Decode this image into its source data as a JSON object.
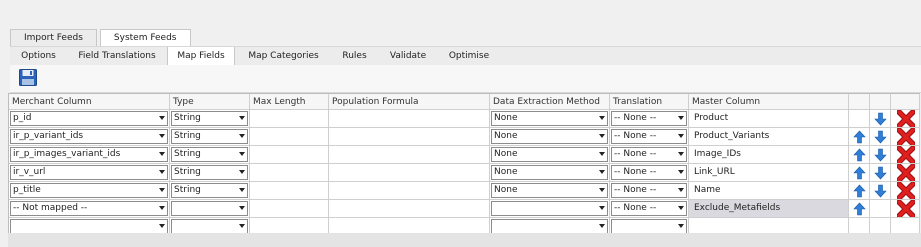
{
  "top_tabs": [
    {
      "label": "Import Feeds",
      "active": false
    },
    {
      "label": "System Feeds",
      "active": true
    }
  ],
  "sub_tabs": [
    {
      "label": "Options",
      "active": false
    },
    {
      "label": "Field Translations",
      "active": false
    },
    {
      "label": "Map Fields",
      "active": true
    },
    {
      "label": "Map Categories",
      "active": false
    },
    {
      "label": "Rules",
      "active": false
    },
    {
      "label": "Validate",
      "active": false
    },
    {
      "label": "Optimise",
      "active": false
    }
  ],
  "toolbar": {
    "save_icon": "save-disk-icon"
  },
  "columns": [
    "Merchant Column",
    "Type",
    "Max Length",
    "Population Formula",
    "Data Extraction Method",
    "Translation",
    "Master Column"
  ],
  "rows": [
    {
      "merchant": "p_id",
      "type": "String",
      "max_length": "",
      "formula": "",
      "extraction": "None",
      "translation": "-- None --",
      "master": "Product",
      "up": false,
      "down": true,
      "del": true,
      "highlight": false
    },
    {
      "merchant": "ir_p_variant_ids",
      "type": "String",
      "max_length": "",
      "formula": "",
      "extraction": "None",
      "translation": "-- None --",
      "master": "Product_Variants",
      "up": true,
      "down": true,
      "del": true,
      "highlight": false
    },
    {
      "merchant": "ir_p_images_variant_ids",
      "type": "String",
      "max_length": "",
      "formula": "",
      "extraction": "None",
      "translation": "-- None --",
      "master": "Image_IDs",
      "up": true,
      "down": true,
      "del": true,
      "highlight": false
    },
    {
      "merchant": "ir_v_url",
      "type": "String",
      "max_length": "",
      "formula": "",
      "extraction": "None",
      "translation": "-- None --",
      "master": "Link_URL",
      "up": true,
      "down": true,
      "del": true,
      "highlight": false
    },
    {
      "merchant": "p_title",
      "type": "String",
      "max_length": "",
      "formula": "",
      "extraction": "None",
      "translation": "-- None --",
      "master": "Name",
      "up": true,
      "down": true,
      "del": true,
      "highlight": false
    },
    {
      "merchant": "-- Not mapped --",
      "type": "",
      "max_length": "",
      "formula": "",
      "extraction": "",
      "translation": "-- None --",
      "master": "Exclude_Metafields",
      "up": true,
      "down": false,
      "del": true,
      "highlight": true
    },
    {
      "merchant": "",
      "type": "",
      "max_length": "",
      "formula": "",
      "extraction": "",
      "translation": "",
      "master": "",
      "up": false,
      "down": false,
      "del": false,
      "highlight": false
    }
  ],
  "icons": {
    "up": "arrow-up-icon",
    "down": "arrow-down-icon",
    "delete": "delete-x-icon"
  },
  "colors": {
    "arrow_blue": "#2f7ed8",
    "delete_red": "#d81e1e",
    "highlight": "#d9d9df"
  }
}
